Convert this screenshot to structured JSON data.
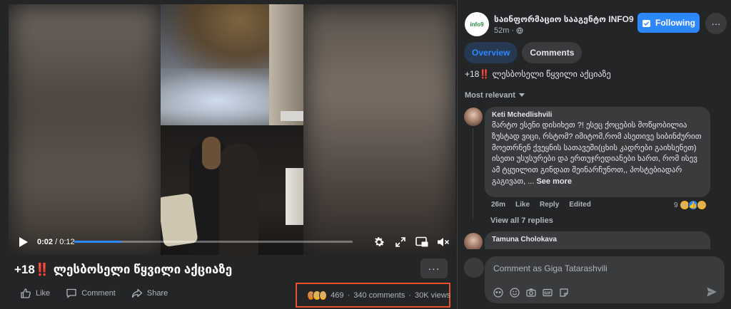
{
  "colors": {
    "accent": "#2d88ff",
    "highlight_box": "#e8502b",
    "background": "#242526",
    "surface": "#3a3b3c"
  },
  "video": {
    "current_time": "0:02",
    "duration": "/ 0:12",
    "progress_fraction": 0.17,
    "icons": [
      "play-icon",
      "settings-icon",
      "fullscreen-icon",
      "picture-in-picture-icon",
      "mute-icon"
    ]
  },
  "post": {
    "title": "+18‼️ ლესბოსელი წყვილი აქციაზე",
    "more_label": "···",
    "actions": {
      "like": "Like",
      "comment": "Comment",
      "share": "Share"
    },
    "stats": {
      "reactions_count": "469",
      "comments": "340 comments",
      "views": "30K views",
      "separator": "·",
      "reaction_icons": [
        "angry-reaction-icon",
        "sad-reaction-icon",
        "haha-reaction-icon"
      ]
    }
  },
  "panel": {
    "page_name": "საინფორმაციო სააგენტო INFO9",
    "logo_text": "info9",
    "post_time": "52m ·",
    "follow_label": "Following",
    "more_label": "···",
    "tabs": [
      {
        "label": "Overview",
        "active": true
      },
      {
        "label": "Comments",
        "active": false
      }
    ],
    "caption": "+18‼️ ლესბოსელი წყვილი აქციაზე",
    "sort_label": "Most relevant",
    "comments": [
      {
        "author": "Keti Mchedlishvili",
        "text": "მარტო ესენი დისიხეთ ?! ესეც ქოცების მოწყობილია ზუსტად ვიცი, რსტომ? იმიტომ,რომ ასეთივე სიბინძურით მოეთრნენ ქვეყნის სათავეში(ცხის კადრები გაიხსენეთ) ისეთი უსუსურები და ერთუჯრედიანები ხართ, რომ ისევ ამ ტყუილით გინდათ შეინარჩუნოთ,, პოსტებიადარ გაგივათ, ...",
        "see_more": "See more",
        "time": "26m",
        "like": "Like",
        "reply": "Reply",
        "edited": "Edited",
        "reaction_count": "9",
        "view_replies": "View all 7 replies"
      },
      {
        "author": "Tamuna Cholokava"
      }
    ],
    "composer_placeholder": "Comment as Giga Tatarashvili"
  }
}
